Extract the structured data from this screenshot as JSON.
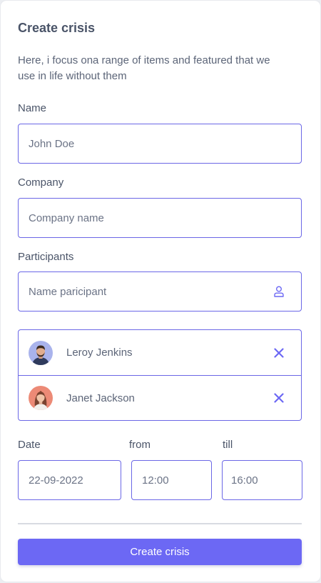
{
  "form": {
    "title": "Create crisis",
    "description": "Here, i focus ona range of items and featured that we use in life without them",
    "name_label": "Name",
    "name_placeholder": "John Doe",
    "company_label": "Company",
    "company_placeholder": "Company name",
    "participants_label": "Participants",
    "participant_placeholder": "Name paricipant",
    "participants": [
      {
        "name": "Leroy Jenkins",
        "avatar": "avatar-man-icon"
      },
      {
        "name": "Janet Jackson",
        "avatar": "avatar-woman-icon"
      }
    ],
    "date_label": "Date",
    "date_value": "22-09-2022",
    "from_label": "from",
    "from_value": "12:00",
    "till_label": "till",
    "till_value": "16:00",
    "submit_label": "Create crisis"
  },
  "colors": {
    "accent": "#6c68f4",
    "border": "#6b67e6",
    "text": "#4a5468",
    "background": "#eceef2"
  }
}
